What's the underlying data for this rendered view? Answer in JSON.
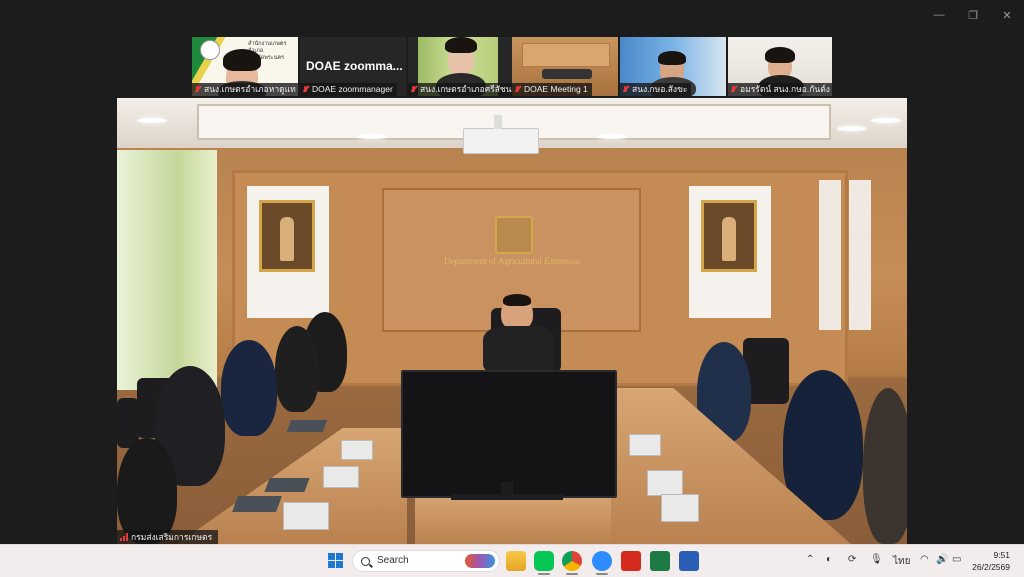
{
  "window_controls": {
    "minimize": "—",
    "restore": "❐",
    "close": "✕"
  },
  "participants": [
    {
      "name": "สนง.เกษตรอำเภอหาดูแท",
      "banner": "สำนักงานเกษตรอำเภอ\nจังหวัดพระนคร"
    },
    {
      "name": "DOAE zoommanager",
      "display": "DOAE  zoomma..."
    },
    {
      "name": "สนง.เกษตรอำเภอศรีสัชนา..."
    },
    {
      "name": "DOAE Meeting 1"
    },
    {
      "name": "สนง.กษอ.สังขะ"
    },
    {
      "name": "อมรรัตน์ สนง.กษอ.กันต์ง"
    }
  ],
  "main_video": {
    "speaker_name": "กรมส่งเสริมการเกษตร",
    "wall_text": "Department of Agricultural Extension"
  },
  "taskbar": {
    "search_label": "Search",
    "apps": [
      "windows-start",
      "search",
      "file-explorer",
      "line",
      "chrome",
      "zoom",
      "acrobat",
      "excel",
      "word"
    ],
    "language": "ไทย",
    "time": "9:51",
    "date": "26/2/2569"
  }
}
